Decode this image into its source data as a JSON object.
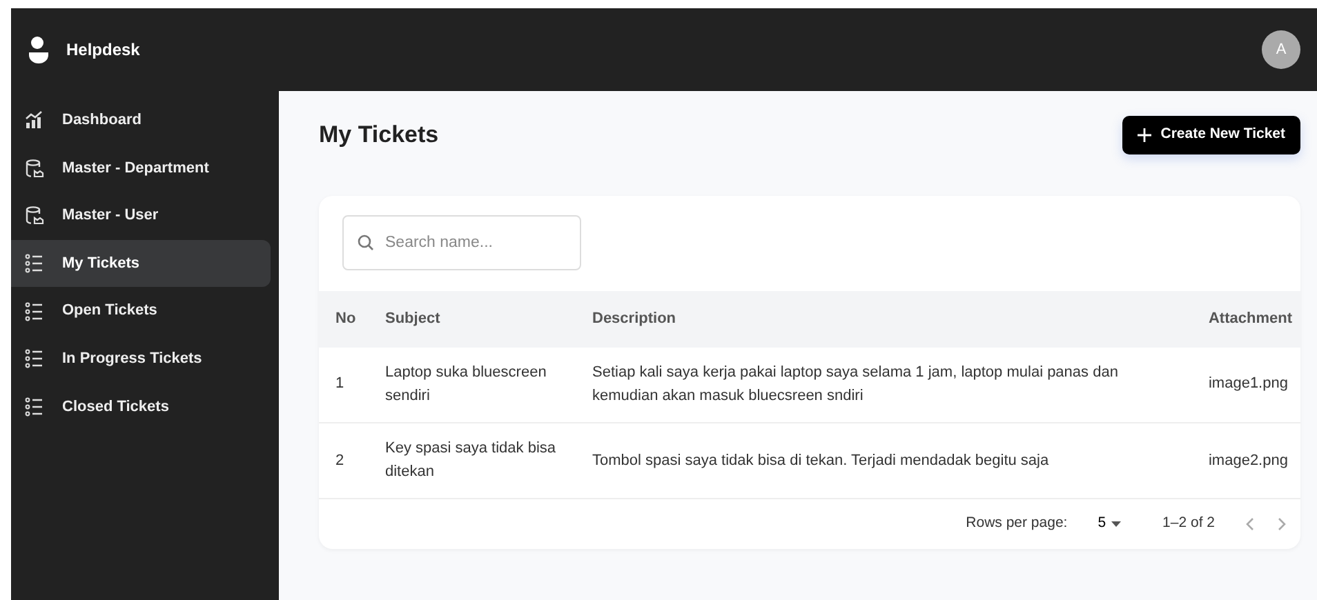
{
  "app": {
    "title": "Helpdesk",
    "avatar": "A"
  },
  "sidebar": {
    "items": [
      {
        "label": "Dashboard",
        "kind": "chart",
        "selected": false
      },
      {
        "label": "Master - Department",
        "kind": "database",
        "selected": false
      },
      {
        "label": "Master - User",
        "kind": "database",
        "selected": false
      },
      {
        "label": "My Tickets",
        "kind": "list",
        "selected": true
      },
      {
        "label": "Open Tickets",
        "kind": "list",
        "selected": false
      },
      {
        "label": "In Progress Tickets",
        "kind": "list",
        "selected": false
      },
      {
        "label": "Closed Tickets",
        "kind": "list",
        "selected": false
      }
    ]
  },
  "page": {
    "title": "My Tickets",
    "create_button": "Create New Ticket"
  },
  "search": {
    "placeholder": "Search name..."
  },
  "table": {
    "columns": [
      "No",
      "Subject",
      "Description",
      "Attachment"
    ],
    "rows": [
      [
        "1",
        "Laptop suka bluescreen sendiri",
        "Setiap kali saya kerja pakai laptop saya selama 1 jam, laptop mulai panas dan kemudian akan masuk bluecsreen sndiri",
        "image1.png"
      ],
      [
        "2",
        "Key spasi saya tidak bisa ditekan",
        "Tombol spasi saya tidak bisa di tekan. Terjadi mendadak begitu saja",
        "image2.png"
      ]
    ]
  },
  "pagination": {
    "rows_per_page_label": "Rows per page:",
    "rows_per_page": "5",
    "range": "1–2 of 2"
  }
}
